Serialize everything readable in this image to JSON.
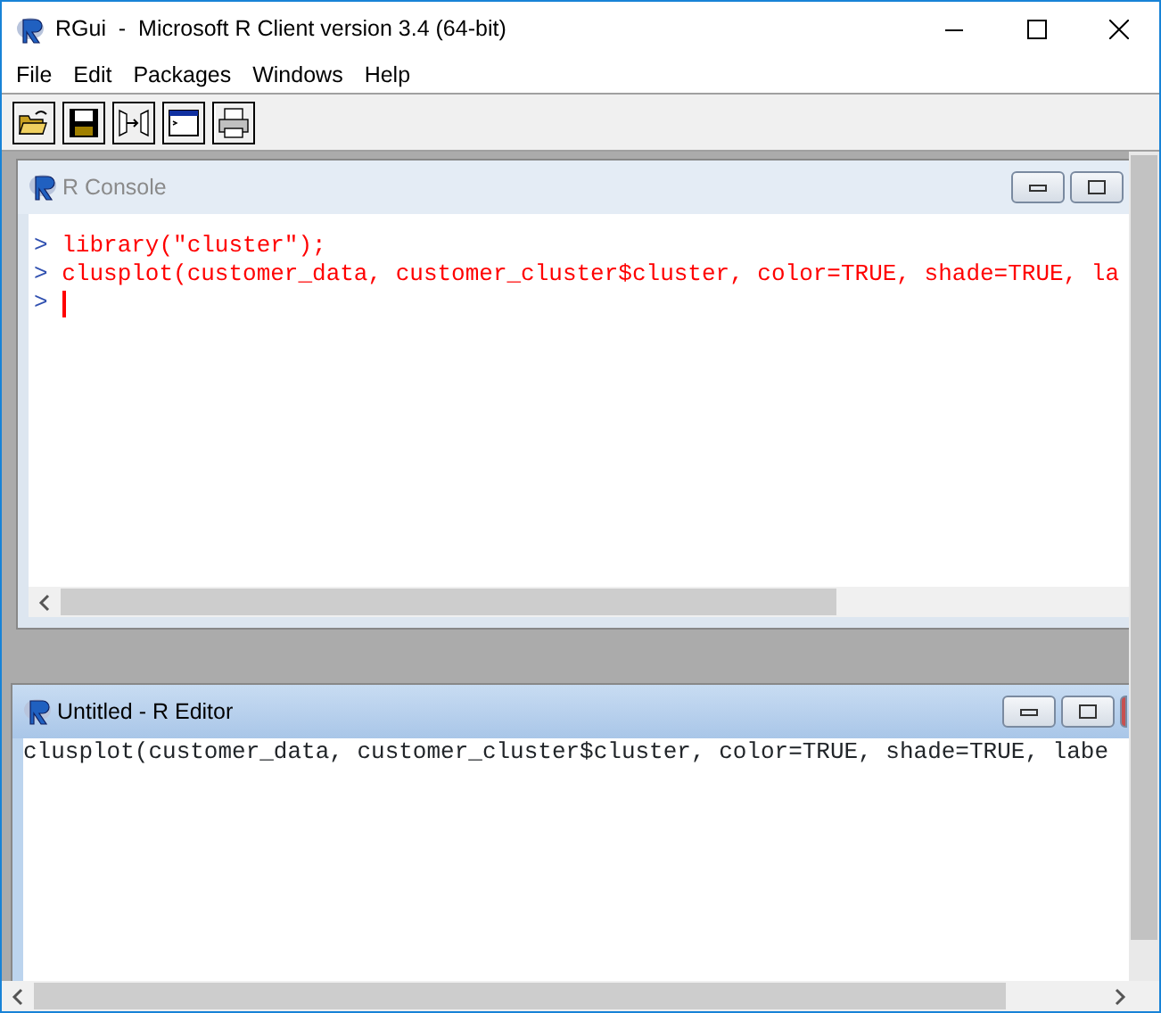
{
  "window": {
    "title": "RGui  -  Microsoft R Client version 3.4 (64-bit)"
  },
  "menu": [
    "File",
    "Edit",
    "Packages",
    "Windows",
    "Help"
  ],
  "toolbar": [
    {
      "kind": "open"
    },
    {
      "kind": "save"
    },
    {
      "kind": "load"
    },
    {
      "kind": "console"
    },
    {
      "kind": "print"
    }
  ],
  "console": {
    "title": "R Console",
    "active": false,
    "lines": [
      {
        "prompt": ">",
        "code": "library(\"cluster\");"
      },
      {
        "prompt": ">",
        "code": "clusplot(customer_data, customer_cluster$cluster, color=TRUE, shade=TRUE, la"
      },
      {
        "prompt": ">",
        "cursor": true
      }
    ]
  },
  "editor": {
    "title": "Untitled - R Editor",
    "active": true,
    "lines": [
      "clusplot(customer_data, customer_cluster$cluster, color=TRUE, shade=TRUE, labe"
    ]
  }
}
